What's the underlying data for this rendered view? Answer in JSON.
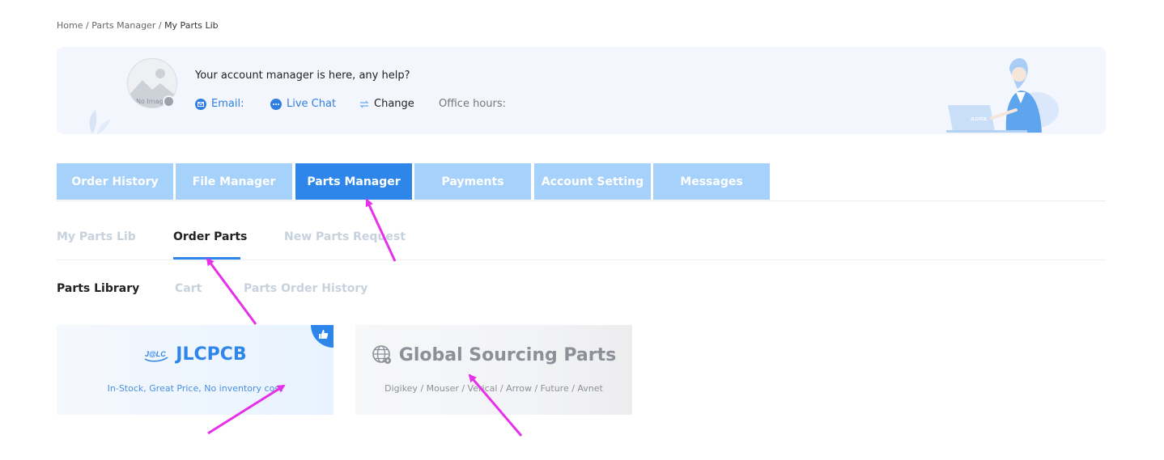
{
  "breadcrumb": {
    "home": "Home",
    "sep": " / ",
    "parts_manager": "Parts Manager",
    "current": "My Parts Lib"
  },
  "account": {
    "avatar_label": "No Image",
    "help_text": "Your account manager is here, any help?",
    "email_label": "Email:",
    "live_chat_label": "Live Chat",
    "change_label": "Change",
    "office_hours_label": "Office hours:",
    "laptop_brand": "JLCPCB"
  },
  "main_tabs": [
    {
      "label": "Order History"
    },
    {
      "label": "File Manager"
    },
    {
      "label": "Parts Manager"
    },
    {
      "label": "Payments"
    },
    {
      "label": "Account Setting"
    },
    {
      "label": "Messages"
    }
  ],
  "sub_tabs": [
    {
      "label": "My Parts Lib"
    },
    {
      "label": "Order Parts"
    },
    {
      "label": "New Parts Request"
    }
  ],
  "third_tabs": [
    {
      "label": "Parts Library"
    },
    {
      "label": "Cart"
    },
    {
      "label": "Parts Order History"
    }
  ],
  "cards": {
    "jlcpcb": {
      "logo_text": "J@LC",
      "title": "JLCPCB",
      "subtitle": "In-Stock, Great Price, No inventory cost"
    },
    "global": {
      "title": "Global Sourcing Parts",
      "subtitle": "Digikey / Mouser / Verical / Arrow / Future / Avnet"
    }
  },
  "colors": {
    "accent": "#2f86ea",
    "tab_inactive": "#a6d1fb",
    "annotation_arrow": "#e532e8"
  }
}
